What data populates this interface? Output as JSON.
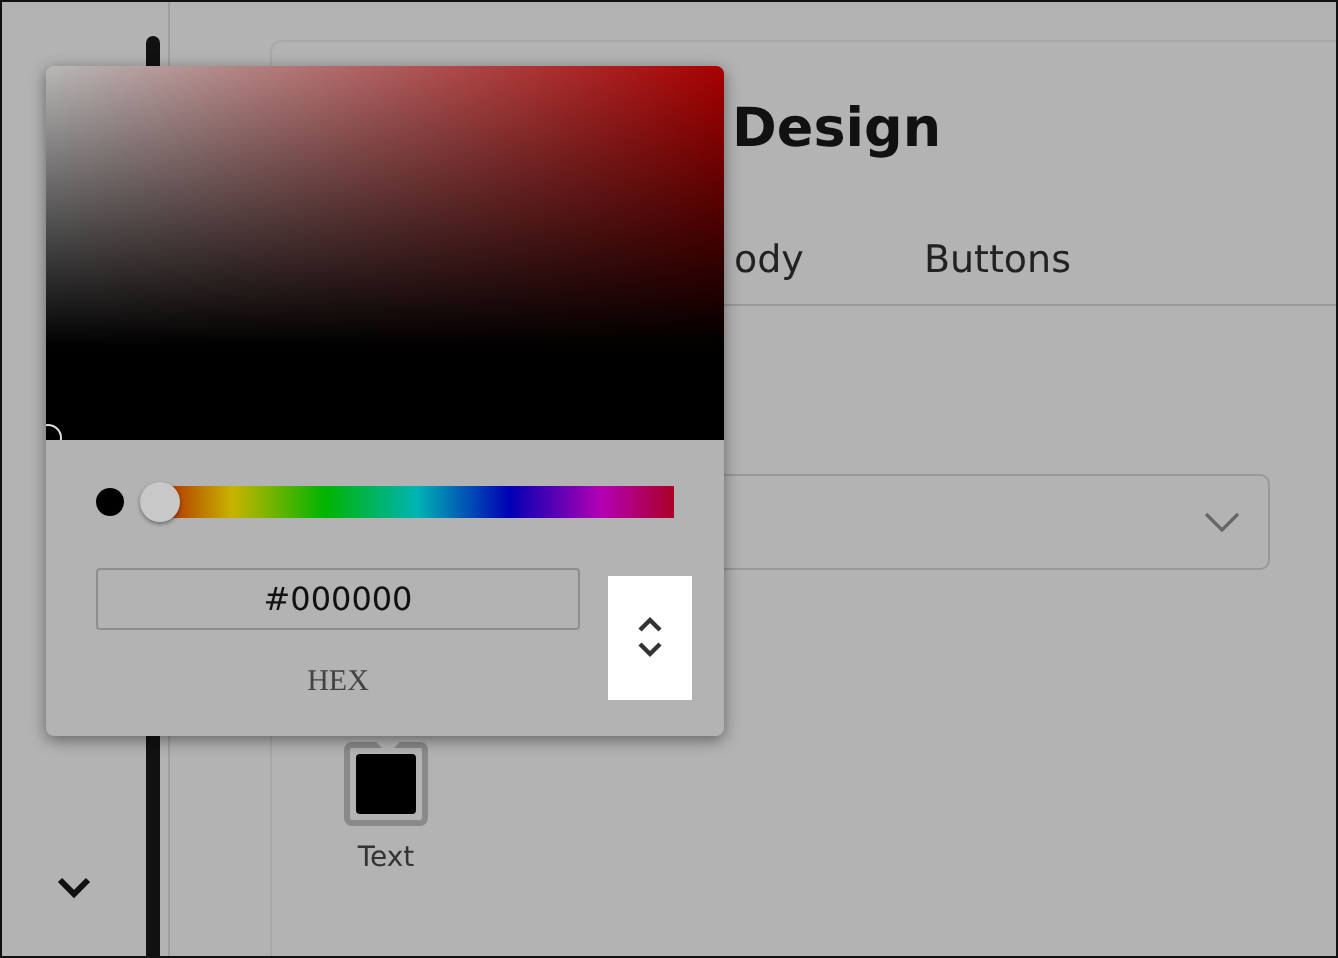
{
  "header": {
    "title": "Design"
  },
  "tabs": [
    {
      "label": "ody"
    },
    {
      "label": "Buttons"
    }
  ],
  "color_swatches": [
    {
      "label": "Text",
      "color": "#000000"
    }
  ],
  "color_picker": {
    "hue": {
      "level": 0
    },
    "hex_value": "#000000",
    "format_label": "HEX"
  }
}
